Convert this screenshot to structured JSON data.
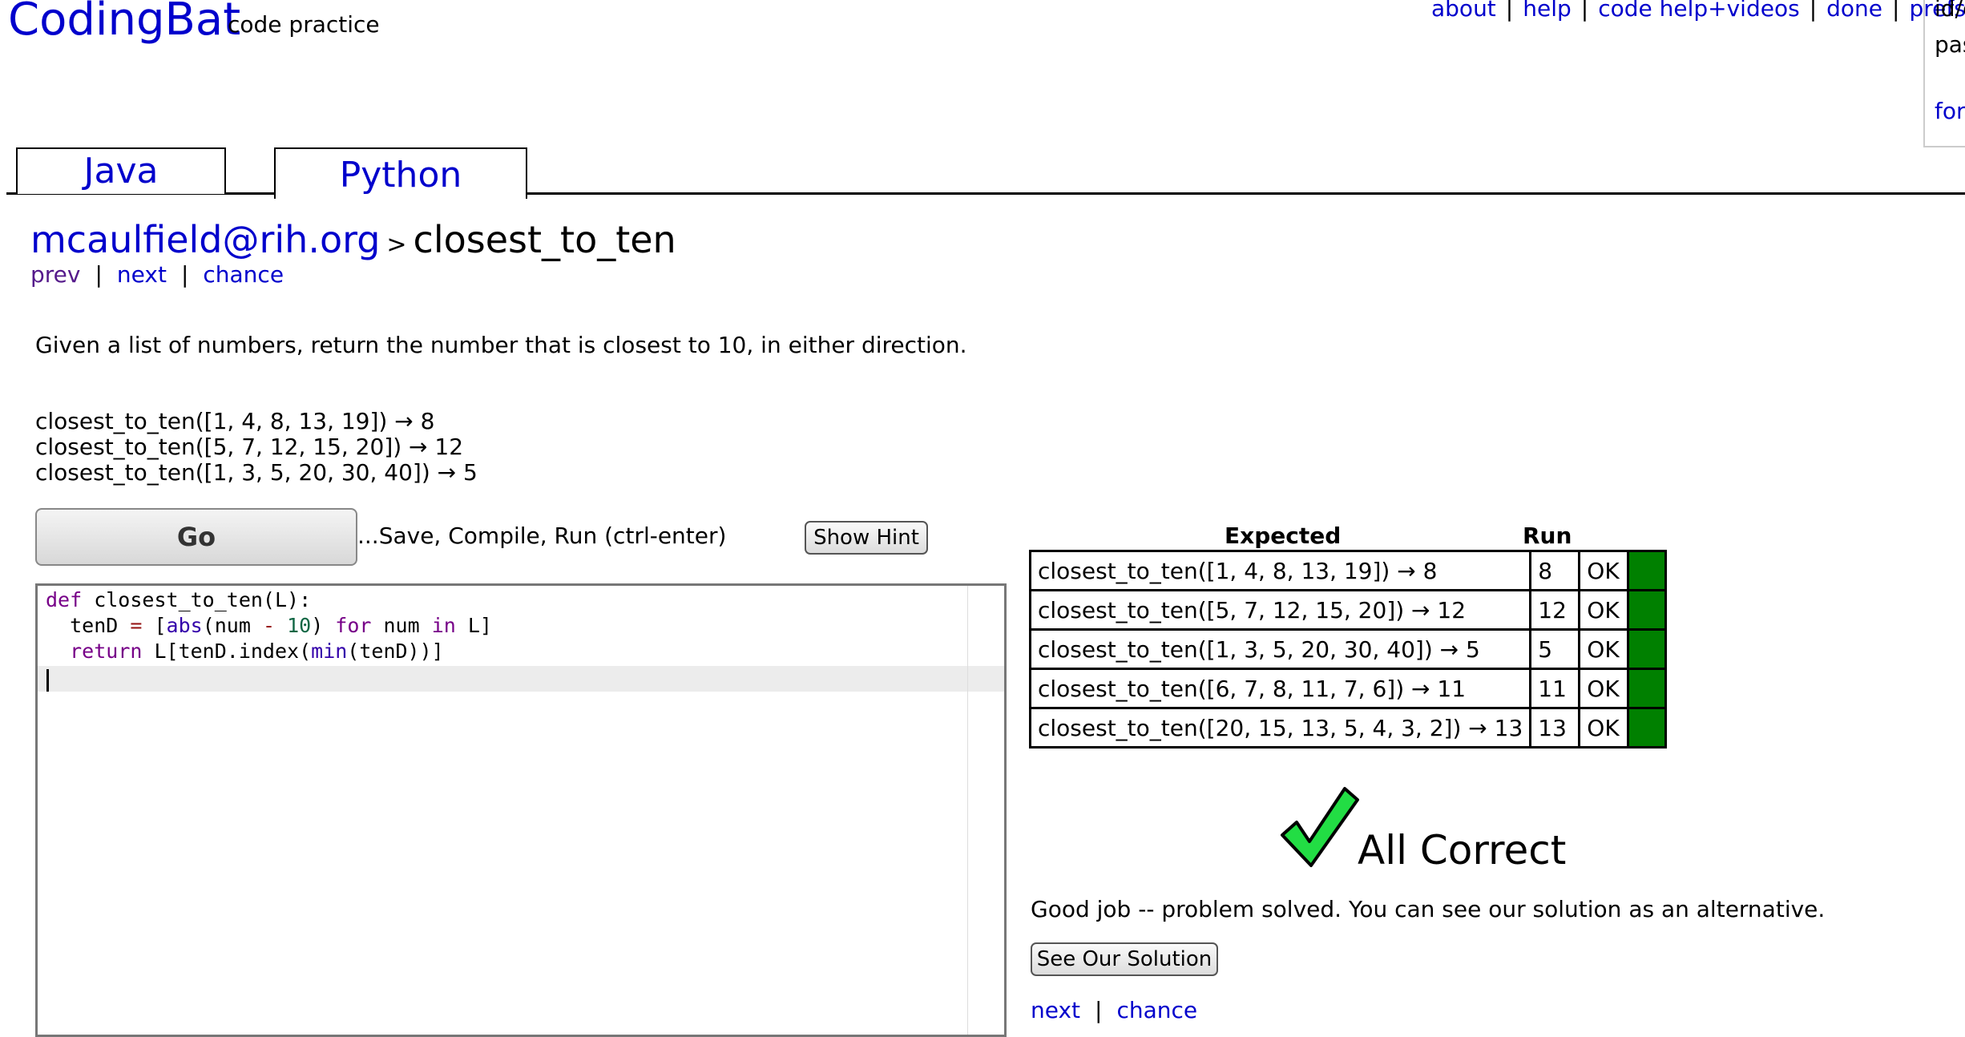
{
  "header": {
    "logo": "CodingBat",
    "logo_sub": "code practice",
    "links": [
      "about",
      "help",
      "code help+videos",
      "done",
      "prefs"
    ],
    "login": {
      "id_label": "id/e",
      "pass_label": "pas",
      "forgot_label": "forg"
    }
  },
  "tabs": [
    {
      "label": "Java",
      "active": false
    },
    {
      "label": "Python",
      "active": true
    }
  ],
  "breadcrumb": {
    "user": "mcaulfield@rih.org",
    "separator": ">",
    "problem": "closest_to_ten"
  },
  "nav_top": {
    "prev": "prev",
    "next": "next",
    "chance": "chance"
  },
  "description": "Given a list of numbers, return the number that is closest to 10, in either direction.",
  "examples": [
    "closest_to_ten([1, 4, 8, 13, 19]) → 8",
    "closest_to_ten([5, 7, 12, 15, 20]) → 12",
    "closest_to_ten([1, 3, 5, 20, 30, 40]) → 5"
  ],
  "go": {
    "button": "Go",
    "caption": "...Save, Compile, Run (ctrl-enter)",
    "hint_button": "Show Hint"
  },
  "editor": {
    "code": [
      "def closest_to_ten(L):",
      "  tenD = [abs(num - 10) for num in L]",
      "  return L[tenD.index(min(tenD))]",
      ""
    ]
  },
  "results": {
    "headers": {
      "expected": "Expected",
      "run": "Run"
    },
    "rows": [
      {
        "expected": "closest_to_ten([1, 4, 8, 13, 19]) → 8",
        "run": "8",
        "status": "OK"
      },
      {
        "expected": "closest_to_ten([5, 7, 12, 15, 20]) → 12",
        "run": "12",
        "status": "OK"
      },
      {
        "expected": "closest_to_ten([1, 3, 5, 20, 30, 40]) → 5",
        "run": "5",
        "status": "OK"
      },
      {
        "expected": "closest_to_ten([6, 7, 8, 11, 7, 6]) → 11",
        "run": "11",
        "status": "OK"
      },
      {
        "expected": "closest_to_ten([20, 15, 13, 5, 4, 3, 2]) → 13",
        "run": "13",
        "status": "OK"
      }
    ],
    "pass_color": "#008000"
  },
  "result_summary": {
    "icon": "checkmark-icon",
    "title": "All Correct",
    "message": "Good job -- problem solved. You can see our solution as an alternative.",
    "solution_button": "See Our Solution"
  },
  "nav_bottom": {
    "next": "next",
    "chance": "chance"
  },
  "colors": {
    "link": "#0000cc",
    "visited": "#551a8b",
    "check": "#22dd44"
  }
}
